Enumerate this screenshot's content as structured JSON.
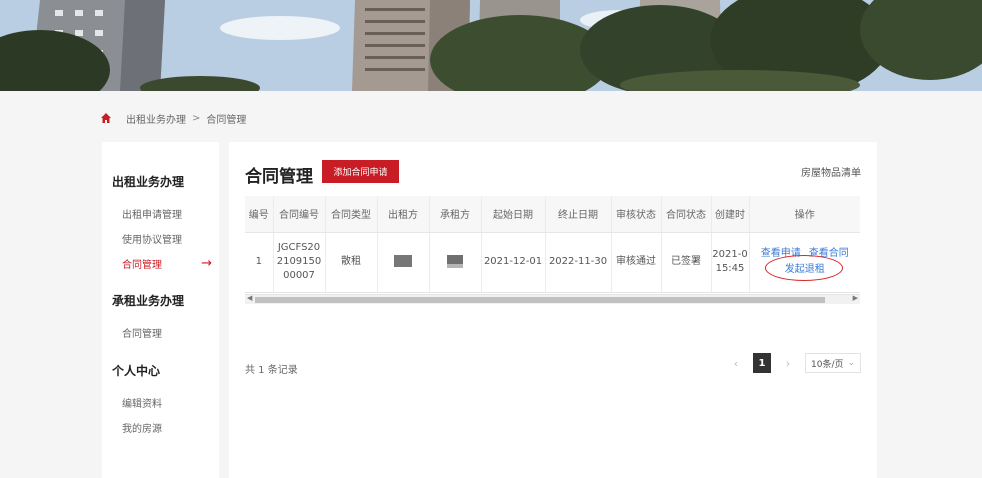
{
  "breadcrumb": {
    "parent": "出租业务办理",
    "separator": ">",
    "current": "合同管理"
  },
  "sidebar": {
    "groups": [
      {
        "title": "出租业务办理",
        "items": [
          "出租申请管理",
          "使用协议管理",
          "合同管理"
        ]
      },
      {
        "title": "承租业务办理",
        "items": [
          "合同管理"
        ]
      },
      {
        "title": "个人中心",
        "items": [
          "编辑资料",
          "我的房源"
        ]
      }
    ],
    "active_arrow": "→"
  },
  "main": {
    "title": "合同管理",
    "add_button": "添加合同申请",
    "top_link": "房屋物品清单",
    "table": {
      "headers": [
        "编号",
        "合同编号",
        "合同类型",
        "出租方",
        "承租方",
        "起始日期",
        "终止日期",
        "审核状态",
        "合同状态",
        "创建时",
        "操作"
      ],
      "rows": [
        {
          "no": "1",
          "contract_no": "JGCFS20210915000007",
          "type": "散租",
          "start": "2021-12-01",
          "end": "2022-11-30",
          "audit": "审核通过",
          "status": "已签署",
          "created_date": "2021-0",
          "created_time": "15:45",
          "ops": {
            "view_apply": "查看申请",
            "view_contract": "查看合同",
            "terminate": "发起退租"
          }
        }
      ]
    },
    "total": "共 1 条记录",
    "pagination": {
      "prev": "‹",
      "current": "1",
      "next": "›",
      "page_size": "10条/页",
      "dropdown": "⌄"
    }
  },
  "colors": {
    "accent": "#c81d25",
    "link": "#3a7bd5"
  }
}
